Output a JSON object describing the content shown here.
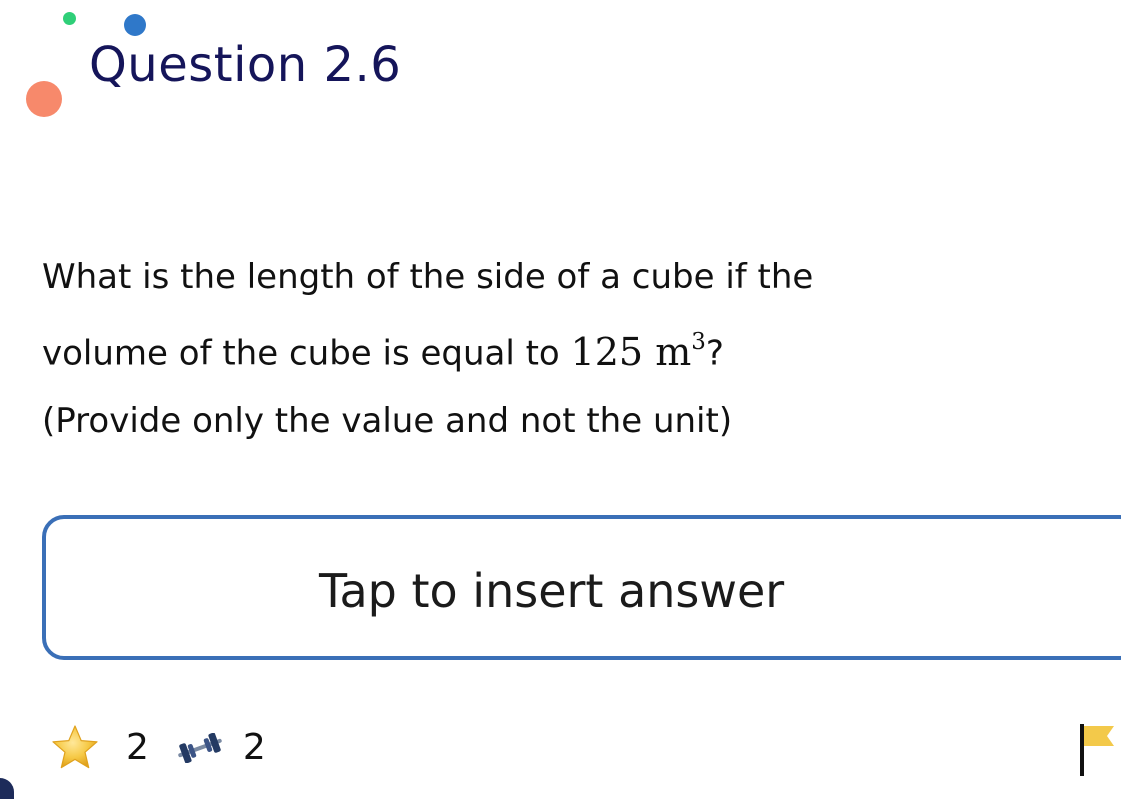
{
  "header": {
    "title": "Question 2.6"
  },
  "question": {
    "line1": "What is the length of the side of a cube if the",
    "line2_prefix": "volume of the cube is equal to",
    "math_value": "125",
    "math_unit": "m",
    "math_exponent": "3",
    "line2_suffix": "?",
    "line3": "(Provide only the value and not the unit)"
  },
  "answer": {
    "placeholder": "Tap to insert answer"
  },
  "footer": {
    "star_count": "2",
    "strength_count": "2",
    "icons": [
      "star-icon",
      "dumbbell-icon",
      "flag-icon"
    ]
  },
  "colors": {
    "title": "#15155a",
    "answer_border": "#3a6fb7",
    "dot_green": "#2fcf78",
    "dot_blue": "#2f78c9",
    "dot_orange": "#f7896b",
    "star": "#f6c945",
    "flag": "#f3c94a"
  }
}
